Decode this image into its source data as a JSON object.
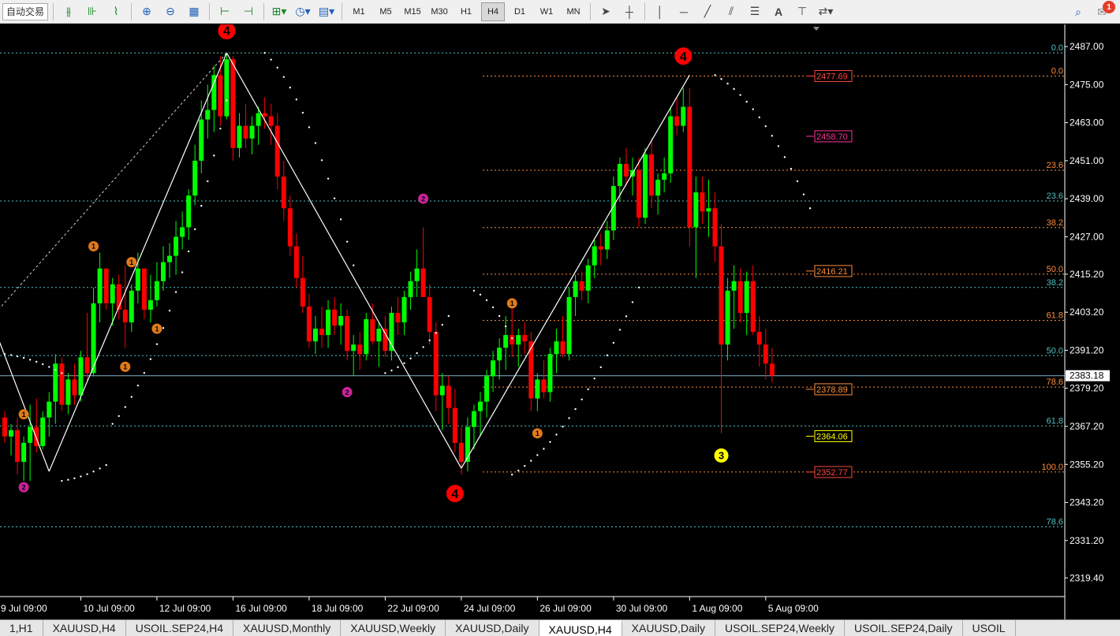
{
  "toolbar": {
    "auto_trading": "自动交易",
    "timeframes": [
      "M1",
      "M5",
      "M15",
      "M30",
      "H1",
      "H4",
      "D1",
      "W1",
      "MN"
    ],
    "active_timeframe": "H4",
    "notification_count": "1",
    "icons": [
      "bar-chart-icon",
      "candle-chart-icon",
      "line-chart-icon",
      "zoom-in-icon",
      "zoom-out-icon",
      "tile-windows-icon",
      "autoscroll-icon",
      "chart-shift-icon",
      "new-indicator-icon",
      "period-clock-icon",
      "template-icon",
      "cursor-icon",
      "crosshair-icon",
      "vertical-line-icon",
      "horizontal-line-icon",
      "trendline-icon",
      "equidistant-channel-icon",
      "fibonacci-icon",
      "text-icon",
      "text-label-icon",
      "arrows-icon",
      "search-icon",
      "notification-icon"
    ]
  },
  "chart_data": {
    "type": "candlestick",
    "symbol": "XAUUSD",
    "timeframe": "H4",
    "colors": {
      "background": "#000000",
      "bull": "#00ff00",
      "bear": "#ff0000",
      "grid": "#000000",
      "axis_text": "#ffffff"
    },
    "ylim": [
      2313.5,
      2491.0
    ],
    "y_ticks": [
      "2487.00",
      "2475.00",
      "2463.00",
      "2451.00",
      "2439.00",
      "2427.00",
      "2415.20",
      "2403.20",
      "2391.20",
      "2379.20",
      "2367.20",
      "2355.20",
      "2343.20",
      "2331.20",
      "2319.40"
    ],
    "x_ticks": [
      "9 Jul 09:00",
      "10 Jul 09:00",
      "12 Jul 09:00",
      "16 Jul 09:00",
      "18 Jul 09:00",
      "22 Jul 09:00",
      "24 Jul 09:00",
      "26 Jul 09:00",
      "30 Jul 09:00",
      "1 Aug 09:00",
      "5 Aug 09:00"
    ],
    "current_price": "2383.18",
    "candles_ohlc": [
      [
        2370.0,
        2372.0,
        2362.0,
        2364.0
      ],
      [
        2364.0,
        2368.0,
        2358.0,
        2366.0
      ],
      [
        2366.0,
        2370.0,
        2352.0,
        2356.0
      ],
      [
        2356.0,
        2364.0,
        2350.0,
        2362.0
      ],
      [
        2362.0,
        2374.0,
        2350.0,
        2367.0
      ],
      [
        2367.0,
        2376.0,
        2359.0,
        2361.0
      ],
      [
        2361.0,
        2372.0,
        2360.0,
        2370.0
      ],
      [
        2370.0,
        2378.0,
        2364.0,
        2375.0
      ],
      [
        2375.0,
        2390.0,
        2368.0,
        2387.0
      ],
      [
        2387.0,
        2389.0,
        2372.0,
        2374.0
      ],
      [
        2374.0,
        2384.0,
        2371.0,
        2382.0
      ],
      [
        2382.0,
        2387.0,
        2374.0,
        2377.0
      ],
      [
        2377.0,
        2391.0,
        2375.0,
        2389.0
      ],
      [
        2389.0,
        2403.0,
        2381.0,
        2384.0
      ],
      [
        2384.0,
        2411.0,
        2383.0,
        2406.0
      ],
      [
        2406.0,
        2422.0,
        2400.0,
        2417.0
      ],
      [
        2417.0,
        2413.0,
        2404.0,
        2406.0
      ],
      [
        2406.0,
        2414.0,
        2399.0,
        2412.0
      ],
      [
        2412.0,
        2415.0,
        2401.0,
        2404.0
      ],
      [
        2404.0,
        2418.0,
        2392.0,
        2400.0
      ],
      [
        2400.0,
        2412.0,
        2397.0,
        2410.0
      ],
      [
        2410.0,
        2422.0,
        2406.0,
        2417.0
      ],
      [
        2417.0,
        2412.0,
        2401.0,
        2404.0
      ],
      [
        2404.0,
        2415.0,
        2400.0,
        2407.0
      ],
      [
        2407.0,
        2419.0,
        2405.0,
        2413.0
      ],
      [
        2413.0,
        2424.0,
        2410.0,
        2419.0
      ],
      [
        2419.0,
        2425.0,
        2414.0,
        2421.0
      ],
      [
        2421.0,
        2432.0,
        2415.0,
        2427.0
      ],
      [
        2427.0,
        2435.0,
        2423.0,
        2430.0
      ],
      [
        2430.0,
        2442.0,
        2426.0,
        2440.0
      ],
      [
        2440.0,
        2456.0,
        2437.0,
        2451.0
      ],
      [
        2451.0,
        2470.0,
        2447.0,
        2464.0
      ],
      [
        2464.0,
        2475.0,
        2458.0,
        2467.0
      ],
      [
        2467.0,
        2481.0,
        2460.0,
        2478.0
      ],
      [
        2478.0,
        2484.0,
        2462.0,
        2465.0
      ],
      [
        2465.0,
        2485.0,
        2464.0,
        2483.0
      ],
      [
        2483.0,
        2484.0,
        2451.0,
        2455.0
      ],
      [
        2455.0,
        2466.0,
        2452.0,
        2462.0
      ],
      [
        2462.0,
        2469.0,
        2455.0,
        2458.0
      ],
      [
        2458.0,
        2465.0,
        2453.0,
        2462.0
      ],
      [
        2462.0,
        2468.0,
        2456.0,
        2466.0
      ],
      [
        2466.0,
        2471.0,
        2461.0,
        2465.0
      ],
      [
        2465.0,
        2469.0,
        2456.0,
        2462.0
      ],
      [
        2462.0,
        2466.0,
        2442.0,
        2446.0
      ],
      [
        2446.0,
        2451.0,
        2432.0,
        2436.0
      ],
      [
        2436.0,
        2440.0,
        2421.0,
        2424.0
      ],
      [
        2424.0,
        2428.0,
        2411.0,
        2414.0
      ],
      [
        2414.0,
        2421.0,
        2403.0,
        2405.0
      ],
      [
        2405.0,
        2409.0,
        2392.0,
        2394.0
      ],
      [
        2394.0,
        2402.0,
        2390.0,
        2398.0
      ],
      [
        2398.0,
        2405.0,
        2392.0,
        2396.0
      ],
      [
        2396.0,
        2407.0,
        2392.0,
        2404.0
      ],
      [
        2404.0,
        2408.0,
        2396.0,
        2399.0
      ],
      [
        2399.0,
        2406.0,
        2393.0,
        2402.0
      ],
      [
        2402.0,
        2404.0,
        2388.0,
        2391.0
      ],
      [
        2391.0,
        2396.0,
        2383.0,
        2393.0
      ],
      [
        2393.0,
        2397.0,
        2385.0,
        2390.0
      ],
      [
        2390.0,
        2403.0,
        2388.0,
        2401.0
      ],
      [
        2401.0,
        2406.0,
        2393.0,
        2394.0
      ],
      [
        2394.0,
        2400.0,
        2386.0,
        2398.0
      ],
      [
        2398.0,
        2402.0,
        2389.0,
        2391.0
      ],
      [
        2391.0,
        2405.0,
        2388.0,
        2403.0
      ],
      [
        2403.0,
        2408.0,
        2396.0,
        2400.0
      ],
      [
        2400.0,
        2410.0,
        2396.0,
        2408.0
      ],
      [
        2408.0,
        2416.0,
        2404.0,
        2413.0
      ],
      [
        2413.0,
        2423.0,
        2408.0,
        2417.0
      ],
      [
        2417.0,
        2430.0,
        2411.0,
        2408.0
      ],
      [
        2408.0,
        2412.0,
        2393.0,
        2397.0
      ],
      [
        2397.0,
        2400.0,
        2372.0,
        2377.0
      ],
      [
        2377.0,
        2384.0,
        2366.0,
        2380.0
      ],
      [
        2380.0,
        2383.0,
        2368.0,
        2373.0
      ],
      [
        2373.0,
        2379.0,
        2359.0,
        2362.0
      ],
      [
        2362.0,
        2367.0,
        2352.0,
        2356.0
      ],
      [
        2356.0,
        2370.0,
        2353.0,
        2367.0
      ],
      [
        2367.0,
        2374.0,
        2360.0,
        2372.0
      ],
      [
        2372.0,
        2378.0,
        2364.0,
        2375.0
      ],
      [
        2375.0,
        2385.0,
        2370.0,
        2383.0
      ],
      [
        2383.0,
        2391.0,
        2378.0,
        2388.0
      ],
      [
        2388.0,
        2395.0,
        2382.0,
        2392.0
      ],
      [
        2392.0,
        2402.0,
        2385.0,
        2396.0
      ],
      [
        2396.0,
        2406.0,
        2389.0,
        2393.0
      ],
      [
        2393.0,
        2398.0,
        2386.0,
        2396.0
      ],
      [
        2396.0,
        2400.0,
        2390.0,
        2394.0
      ],
      [
        2394.0,
        2397.0,
        2372.0,
        2376.0
      ],
      [
        2376.0,
        2384.0,
        2372.0,
        2382.0
      ],
      [
        2382.0,
        2388.0,
        2376.0,
        2378.0
      ],
      [
        2378.0,
        2392.0,
        2375.0,
        2390.0
      ],
      [
        2390.0,
        2398.0,
        2384.0,
        2394.0
      ],
      [
        2394.0,
        2402.0,
        2389.0,
        2390.0
      ],
      [
        2390.0,
        2411.0,
        2388.0,
        2408.0
      ],
      [
        2408.0,
        2415.0,
        2402.0,
        2413.0
      ],
      [
        2413.0,
        2416.0,
        2407.0,
        2410.0
      ],
      [
        2410.0,
        2420.0,
        2406.0,
        2418.0
      ],
      [
        2418.0,
        2426.0,
        2414.0,
        2424.0
      ],
      [
        2424.0,
        2428.0,
        2418.0,
        2423.0
      ],
      [
        2423.0,
        2432.0,
        2420.0,
        2429.0
      ],
      [
        2429.0,
        2446.0,
        2426.0,
        2443.0
      ],
      [
        2443.0,
        2452.0,
        2438.0,
        2450.0
      ],
      [
        2450.0,
        2455.0,
        2443.0,
        2446.0
      ],
      [
        2446.0,
        2452.0,
        2440.0,
        2448.0
      ],
      [
        2448.0,
        2452.0,
        2430.0,
        2433.0
      ],
      [
        2433.0,
        2455.0,
        2431.0,
        2453.0
      ],
      [
        2453.0,
        2458.0,
        2436.0,
        2440.0
      ],
      [
        2440.0,
        2447.0,
        2434.0,
        2445.0
      ],
      [
        2445.0,
        2452.0,
        2441.0,
        2447.0
      ],
      [
        2447.0,
        2468.0,
        2444.0,
        2465.0
      ],
      [
        2465.0,
        2471.0,
        2459.0,
        2462.0
      ],
      [
        2462.0,
        2474.0,
        2460.0,
        2468.0
      ],
      [
        2468.0,
        2474.0,
        2424.0,
        2430.0
      ],
      [
        2430.0,
        2446.0,
        2414.0,
        2441.0
      ],
      [
        2441.0,
        2446.0,
        2431.0,
        2435.0
      ],
      [
        2435.0,
        2445.0,
        2427.0,
        2436.0
      ],
      [
        2436.0,
        2441.0,
        2419.0,
        2424.0
      ],
      [
        2424.0,
        2431.0,
        2365.0,
        2393.0
      ],
      [
        2393.0,
        2414.0,
        2388.0,
        2410.0
      ],
      [
        2410.0,
        2418.0,
        2398.0,
        2413.0
      ],
      [
        2413.0,
        2417.0,
        2400.0,
        2403.0
      ],
      [
        2403.0,
        2416.0,
        2396.0,
        2413.0
      ],
      [
        2413.0,
        2418.0,
        2396.0,
        2397.0
      ],
      [
        2397.0,
        2402.0,
        2386.0,
        2393.0
      ],
      [
        2393.0,
        2398.0,
        2382.0,
        2387.0
      ],
      [
        2387.0,
        2392.0,
        2381.0,
        2383.18
      ]
    ],
    "zigzag_points": [
      {
        "i": -2,
        "price": 2400.0
      },
      {
        "i": 7,
        "price": 2353.0
      },
      {
        "i": 35,
        "price": 2485.0
      },
      {
        "i": 72,
        "price": 2354.0
      },
      {
        "i": 108,
        "price": 2478.0
      }
    ],
    "fib_right": {
      "color": "#ff8c3a",
      "levels": [
        {
          "label": "0.0",
          "price": 2477.69
        },
        {
          "label": "23.6",
          "price": 2448.0
        },
        {
          "label": "38.2",
          "price": 2429.9
        },
        {
          "label": "50.0",
          "price": 2415.2
        },
        {
          "label": "61.8",
          "price": 2400.6
        },
        {
          "label": "78.6",
          "price": 2379.6
        },
        {
          "label": "100.0",
          "price": 2352.8
        }
      ]
    },
    "fib_left": {
      "color": "#4fc0c0",
      "levels": [
        {
          "label": "0.0",
          "price": 2485.0
        },
        {
          "label": "23.6",
          "price": 2438.3
        },
        {
          "label": "38.2",
          "price": 2411.0
        },
        {
          "label": "50.0",
          "price": 2389.5
        },
        {
          "label": "61.8",
          "price": 2367.3
        },
        {
          "label": "78.6",
          "price": 2335.5
        }
      ]
    },
    "price_labels": [
      {
        "text": "2477.69",
        "price": 2477.7,
        "color": "#ff4444",
        "border": "#ff4444"
      },
      {
        "text": "2458.70",
        "price": 2458.7,
        "color": "#ff3399",
        "border": "#ff3399"
      },
      {
        "text": "2416.21",
        "price": 2416.2,
        "color": "#ff8c3a",
        "border": "#ff8c3a"
      },
      {
        "text": "2378.89",
        "price": 2378.9,
        "color": "#ff8c3a",
        "border": "#ff8c3a"
      },
      {
        "text": "2364.06",
        "price": 2364.1,
        "color": "#ffff00",
        "border": "#ffff00"
      },
      {
        "text": "2352.77",
        "price": 2352.8,
        "color": "#ff4444",
        "border": "#ff4444"
      }
    ],
    "wave_labels": [
      {
        "text": "4",
        "i": 35,
        "price": 2492.0,
        "color": "#ff0000",
        "size": "big"
      },
      {
        "text": "4",
        "i": 107,
        "price": 2484.0,
        "color": "#ff0000",
        "size": "big"
      },
      {
        "text": "4",
        "i": 71,
        "price": 2346.0,
        "color": "#ff0000",
        "size": "big"
      },
      {
        "text": "3",
        "i": 113,
        "price": 2358.0,
        "color": "#ffff00",
        "size": "mid"
      },
      {
        "text": "2",
        "i": 3,
        "price": 2348.0,
        "color": "#cc2299",
        "size": "small"
      },
      {
        "text": "2",
        "i": 54,
        "price": 2378.0,
        "color": "#cc2299",
        "size": "small"
      },
      {
        "text": "2",
        "i": 66,
        "price": 2439.0,
        "color": "#cc2299",
        "size": "small"
      },
      {
        "text": "1",
        "i": 3,
        "price": 2371.0,
        "color": "#e07a1a",
        "size": "small"
      },
      {
        "text": "1",
        "i": 14,
        "price": 2424.0,
        "color": "#e07a1a",
        "size": "small"
      },
      {
        "text": "1",
        "i": 20,
        "price": 2419.0,
        "color": "#e07a1a",
        "size": "small"
      },
      {
        "text": "1",
        "i": 19,
        "price": 2386.0,
        "color": "#e07a1a",
        "size": "small"
      },
      {
        "text": "1",
        "i": 24,
        "price": 2398.0,
        "color": "#e07a1a",
        "size": "small"
      },
      {
        "text": "1",
        "i": 80,
        "price": 2406.0,
        "color": "#e07a1a",
        "size": "small"
      },
      {
        "text": "1",
        "i": 84,
        "price": 2365.0,
        "color": "#e07a1a",
        "size": "small"
      }
    ]
  },
  "tabs": [
    "1,H1",
    "XAUUSD,H4",
    "USOIL.SEP24,H4",
    "XAUUSD,Monthly",
    "XAUUSD,Weekly",
    "XAUUSD,Daily",
    "XAUUSD,H4",
    "XAUUSD,Daily",
    "USOIL.SEP24,Weekly",
    "USOIL.SEP24,Daily",
    "USOIL"
  ],
  "active_tab": 6
}
